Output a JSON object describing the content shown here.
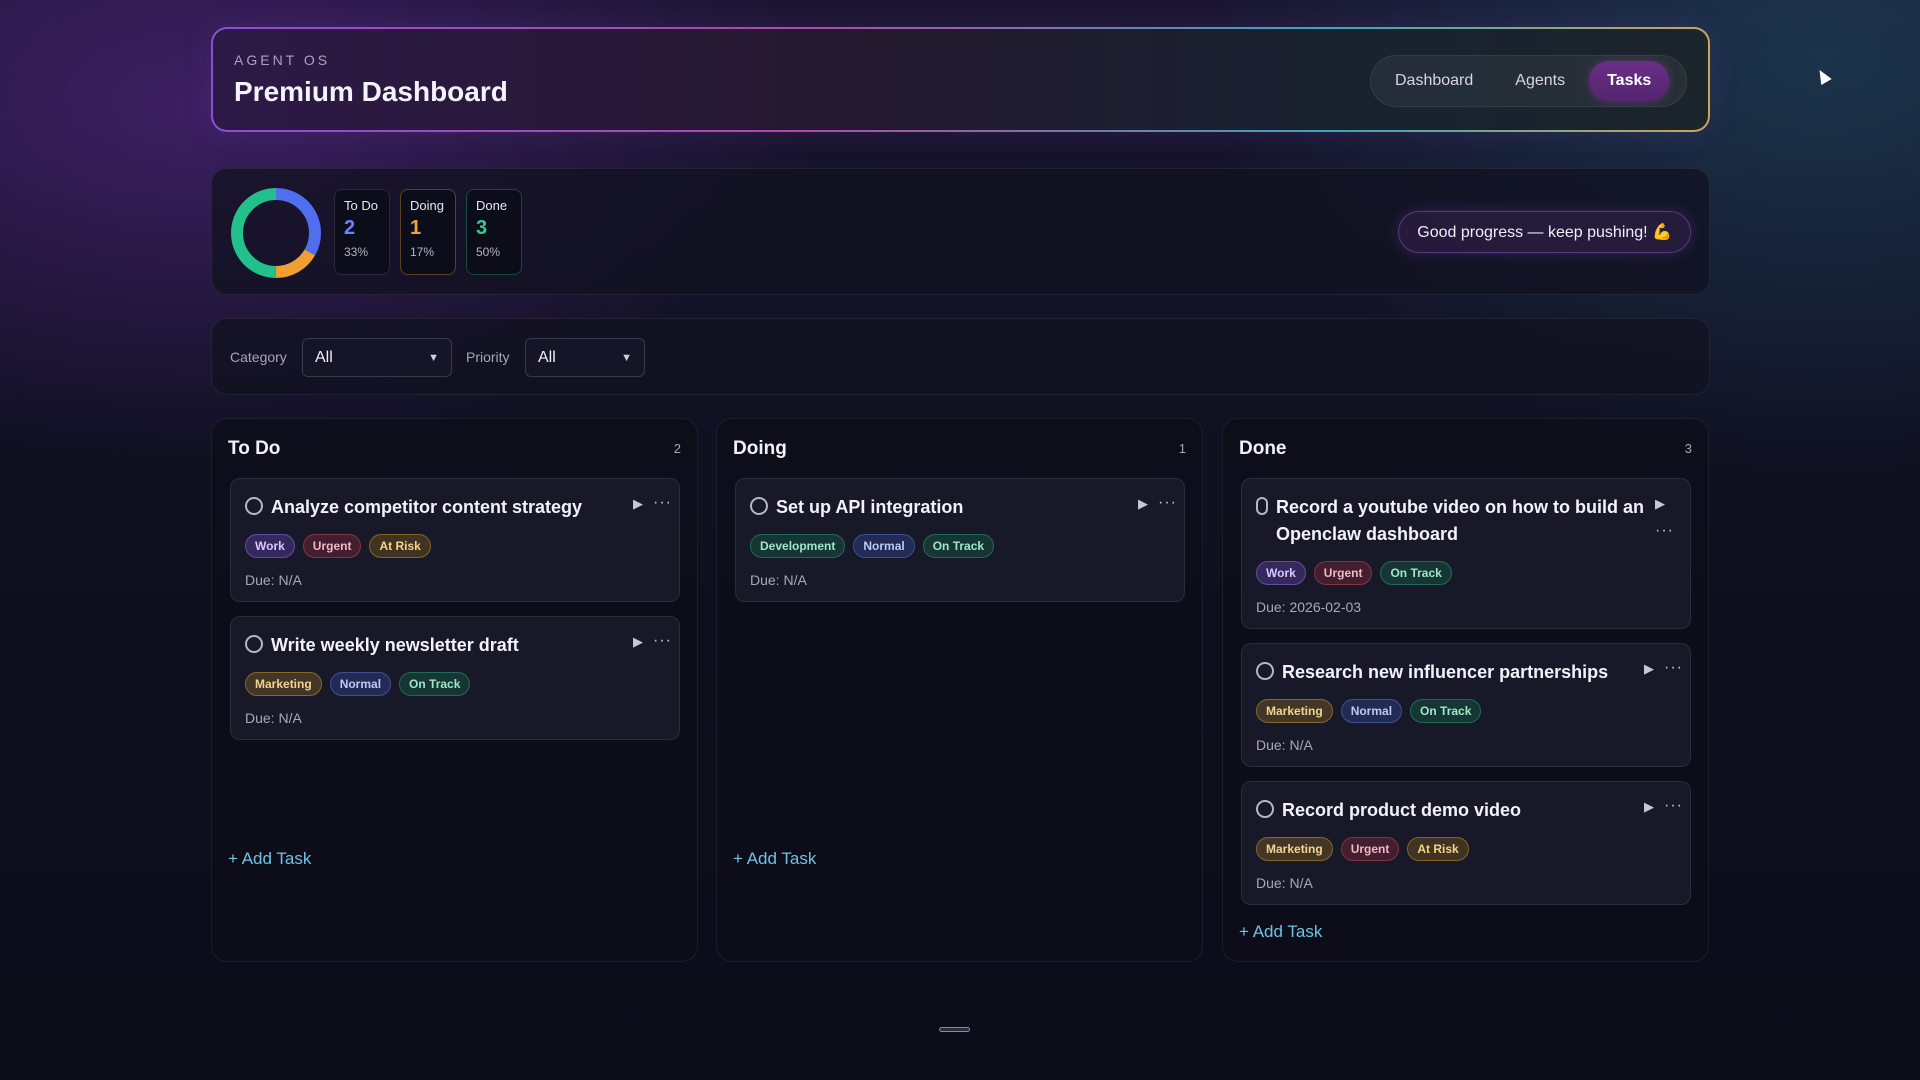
{
  "header": {
    "kicker": "AGENT OS",
    "title": "Premium Dashboard",
    "nav": [
      {
        "label": "Dashboard",
        "active": false
      },
      {
        "label": "Agents",
        "active": false
      },
      {
        "label": "Tasks",
        "active": true
      }
    ]
  },
  "stats": {
    "donut": [
      {
        "name": "To Do",
        "fraction": 0.333,
        "color": "#4f6ff0"
      },
      {
        "name": "Doing",
        "fraction": 0.167,
        "color": "#f0a030"
      },
      {
        "name": "Done",
        "fraction": 0.5,
        "color": "#22c08a"
      }
    ],
    "boxes": [
      {
        "label": "To Do",
        "count": "2",
        "pct": "33%",
        "color": "#6a86ff"
      },
      {
        "label": "Doing",
        "count": "1",
        "pct": "17%",
        "color": "#f0a53a"
      },
      {
        "label": "Done",
        "count": "3",
        "pct": "50%",
        "color": "#2fcf95"
      }
    ],
    "message": "Good progress — keep pushing! 💪"
  },
  "filters": {
    "category_label": "Category",
    "category_value": "All",
    "priority_label": "Priority",
    "priority_value": "All"
  },
  "columns": [
    {
      "title": "To Do",
      "count": "2",
      "add_label": "+ Add Task",
      "cards": [
        {
          "title": "Analyze competitor content strategy",
          "tags": [
            "Work",
            "Urgent",
            "At Risk"
          ],
          "due": "Due: N/A"
        },
        {
          "title": "Write weekly newsletter draft",
          "tags": [
            "Marketing",
            "Normal",
            "On Track"
          ],
          "due": "Due: N/A"
        }
      ]
    },
    {
      "title": "Doing",
      "count": "1",
      "add_label": "+ Add Task",
      "cards": [
        {
          "title": "Set up API integration",
          "tags": [
            "Development",
            "Normal",
            "On Track"
          ],
          "due": "Due: N/A"
        }
      ]
    },
    {
      "title": "Done",
      "count": "3",
      "add_label": "+ Add Task",
      "cards": [
        {
          "title_line1": "Record a youtube video on how to build an",
          "title_line2": "Openclaw dashboard",
          "tags": [
            "Work",
            "Urgent",
            "On Track"
          ],
          "due": "Due: 2026-02-03"
        },
        {
          "title": "Research new influencer partnerships",
          "tags": [
            "Marketing",
            "Normal",
            "On Track"
          ],
          "due": "Due: N/A"
        },
        {
          "title": "Record product demo video",
          "tags": [
            "Marketing",
            "Urgent",
            "At Risk"
          ],
          "due": "Due: N/A"
        }
      ]
    }
  ],
  "icons": {
    "play": "play-icon",
    "more": "more-options-icon",
    "check": "circle-checkbox-icon",
    "chevron": "chevron-down-icon"
  }
}
